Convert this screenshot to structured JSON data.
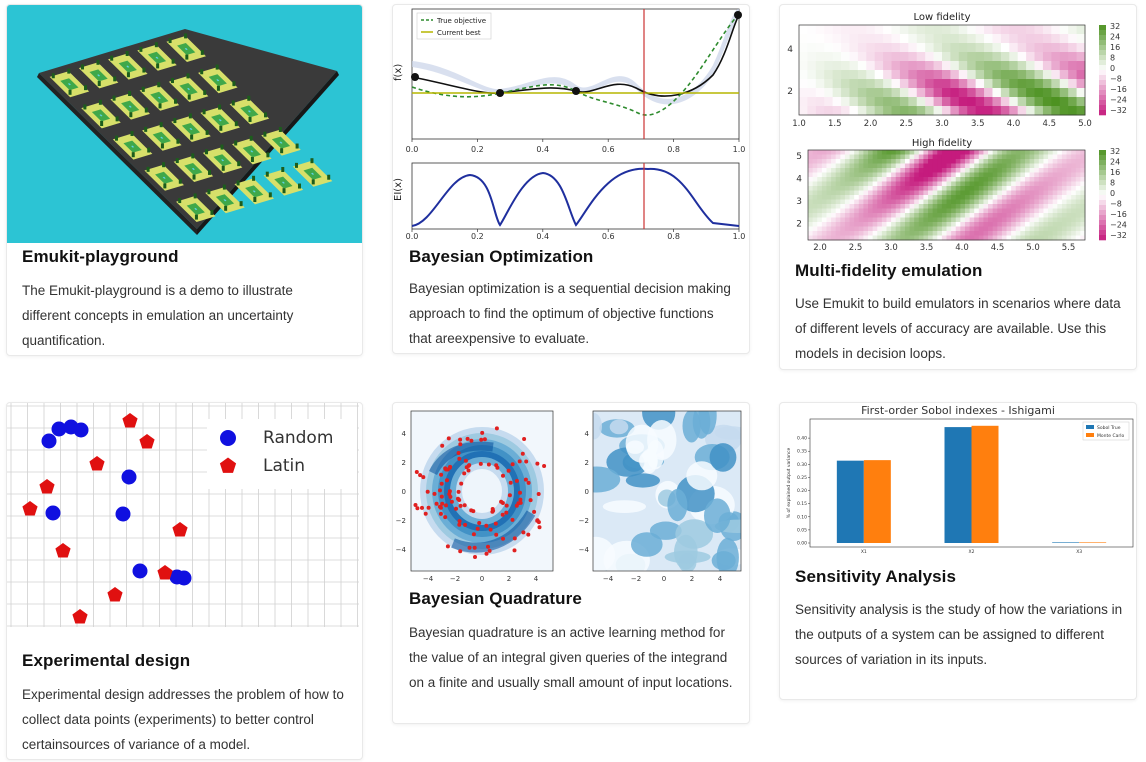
{
  "cards": [
    {
      "title": "Emukit-playground",
      "text": "The Emukit-playground is a demo to illustrate different concepts in emulation an uncertainty quantification.",
      "image": "3d-city-grid-playground"
    },
    {
      "title": "Bayesian Optimization",
      "text": "Bayesian optimization is a sequential decision making approach to find the optimum of objective functions that areexpensive to evaluate.",
      "image": "bayesian-optimization-plot",
      "figure": {
        "legend": [
          "True objective",
          "Current best"
        ],
        "top_ylabel": "f(x)",
        "bottom_ylabel": "EI(x)",
        "xticks": [
          "0.0",
          "0.2",
          "0.4",
          "0.6",
          "0.8",
          "1.0"
        ],
        "colors": {
          "objective": "#2e8b2e",
          "best": "#b5b500",
          "marker": "#cc3333",
          "mean": "#1a1a2e",
          "ei": "#1f2f9e"
        }
      }
    },
    {
      "title": "Multi-fidelity emulation",
      "text": "Use Emukit to build emulators in scenarios where data of different levels of accuracy are available. Use this models in decision loops.",
      "image": "multi-fidelity-heatmaps",
      "figure": {
        "low_title": "Low fidelity",
        "high_title": "High fidelity",
        "low_yticks": [
          "4",
          "2"
        ],
        "low_xticks": [
          "1.0",
          "1.5",
          "2.0",
          "2.5",
          "3.0",
          "3.5",
          "4.0",
          "4.5",
          "5.0"
        ],
        "high_yticks": [
          "5",
          "4",
          "3",
          "2"
        ],
        "high_xticks": [
          "2.0",
          "2.5",
          "3.0",
          "3.5",
          "4.0",
          "4.5",
          "5.0",
          "5.5"
        ],
        "colorbar_ticks": [
          "32",
          "24",
          "16",
          "8",
          "0",
          "−8",
          "−16",
          "−24",
          "−32"
        ],
        "colors": {
          "positive": "#4d9221",
          "negative": "#c51b7d"
        }
      }
    },
    {
      "title": "Experimental design",
      "text": "Experimental design addresses the problem of how to collect data points (experiments) to better control certainsources of variance of a model.",
      "image": "random-vs-latin-design",
      "figure": {
        "legend": [
          "Random",
          "Latin"
        ],
        "colors": {
          "random": "#1010e0",
          "latin": "#e01010"
        }
      }
    },
    {
      "title": "Bayesian Quadrature",
      "text": "Bayesian quadrature is an active learning method for the value of an integral given queries of the integrand on a finite and usually small amount of input locations.",
      "image": "bayesian-quadrature-contours",
      "figure": {
        "left_yticks": [
          "4",
          "2",
          "0",
          "−2",
          "−4"
        ],
        "xticks": [
          "−4",
          "−2",
          "0",
          "2",
          "4"
        ],
        "right_yticks": [
          "4",
          "2",
          "0",
          "−2",
          "−4"
        ],
        "colors": {
          "contour": "#2166ac",
          "point": "#e02020"
        }
      }
    },
    {
      "title": "Sensitivity Analysis",
      "text": "Sensitivity analysis is the study of how the variations in the outputs of a system can be assigned to different sources of variation in its inputs.",
      "image": "sobol-indexes-bar-chart",
      "figure": {
        "title": "First-order Sobol indexes - Ishigami",
        "ylabel": "% of explained output variance",
        "legend": [
          "Sobol True",
          "Monte Carlo"
        ],
        "yticks": [
          "0.40",
          "0.35",
          "0.30",
          "0.25",
          "0.20",
          "0.15",
          "0.10",
          "0.05",
          "0.00"
        ],
        "categories": [
          "X1",
          "X2",
          "X3"
        ],
        "colors": {
          "true": "#1f77b4",
          "mc": "#ff7f0e"
        }
      }
    }
  ],
  "chart_data": {
    "type": "bar",
    "title": "First-order Sobol indexes - Ishigami",
    "ylabel": "% of explained output variance",
    "categories": [
      "X1",
      "X2",
      "X3"
    ],
    "series": [
      {
        "name": "Sobol True",
        "values": [
          0.314,
          0.442,
          0.0
        ]
      },
      {
        "name": "Monte Carlo",
        "values": [
          0.316,
          0.447,
          0.001
        ]
      }
    ],
    "ylim": [
      0,
      0.45
    ]
  }
}
